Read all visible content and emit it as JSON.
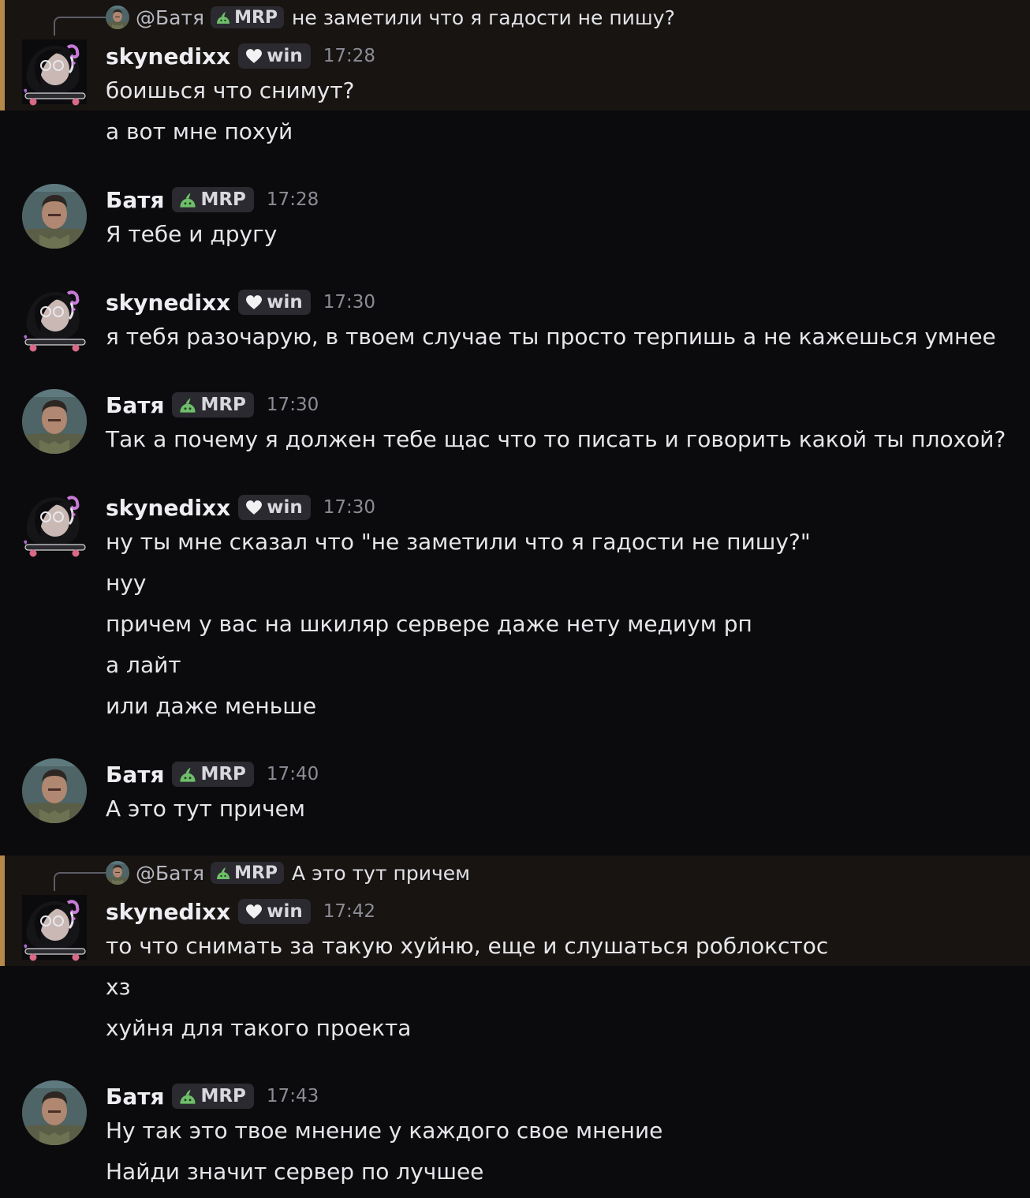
{
  "users": {
    "sky": {
      "name": "skynedixx",
      "tag": "win"
    },
    "batya": {
      "name": "Батя",
      "tag": "MRP"
    }
  },
  "colors": {
    "background": "#0b0b0d",
    "highlight": "#171411",
    "highlight_bar": "#b5894b",
    "tag_bg": "#2a2a30"
  },
  "icons": {
    "sky_tag": "heart-icon",
    "batya_tag": "slime-icon"
  },
  "replies": [
    {
      "mention": "@Батя",
      "tag": "MRP",
      "text": "не заметили что я гадости не пишу?"
    },
    {
      "mention": "@Батя",
      "tag": "MRP",
      "text": "А это тут причем"
    }
  ],
  "messages": [
    {
      "author": "skynedixx",
      "time": "17:28",
      "lines": [
        "боишься что снимут?",
        "а вот мне похуй"
      ]
    },
    {
      "author": "Батя",
      "time": "17:28",
      "lines": [
        "Я тебе и другу"
      ]
    },
    {
      "author": "skynedixx",
      "time": "17:30",
      "lines": [
        "я тебя разочарую, в твоем случае ты просто терпишь а не кажешься умнее"
      ]
    },
    {
      "author": "Батя",
      "time": "17:30",
      "lines": [
        "Так а почему я должен тебе щас что то писать и говорить какой ты плохой?"
      ]
    },
    {
      "author": "skynedixx",
      "time": "17:30",
      "lines": [
        "ну ты мне сказал что \"не заметили что я гадости не пишу?\"",
        "нуу",
        "причем у вас на шкиляр сервере даже нету медиум рп",
        "а лайт",
        "или даже меньше"
      ]
    },
    {
      "author": "Батя",
      "time": "17:40",
      "lines": [
        "А это тут причем"
      ]
    },
    {
      "author": "skynedixx",
      "time": "17:42",
      "lines": [
        "то что снимать за такую хуйню, еще и слушаться роблокстос",
        "хз",
        "хуйня для такого проекта"
      ]
    },
    {
      "author": "Батя",
      "time": "17:43",
      "lines": [
        "Ну так это твое мнение у каждого свое мнение",
        "Найди значит сервер по лучшее"
      ]
    }
  ]
}
